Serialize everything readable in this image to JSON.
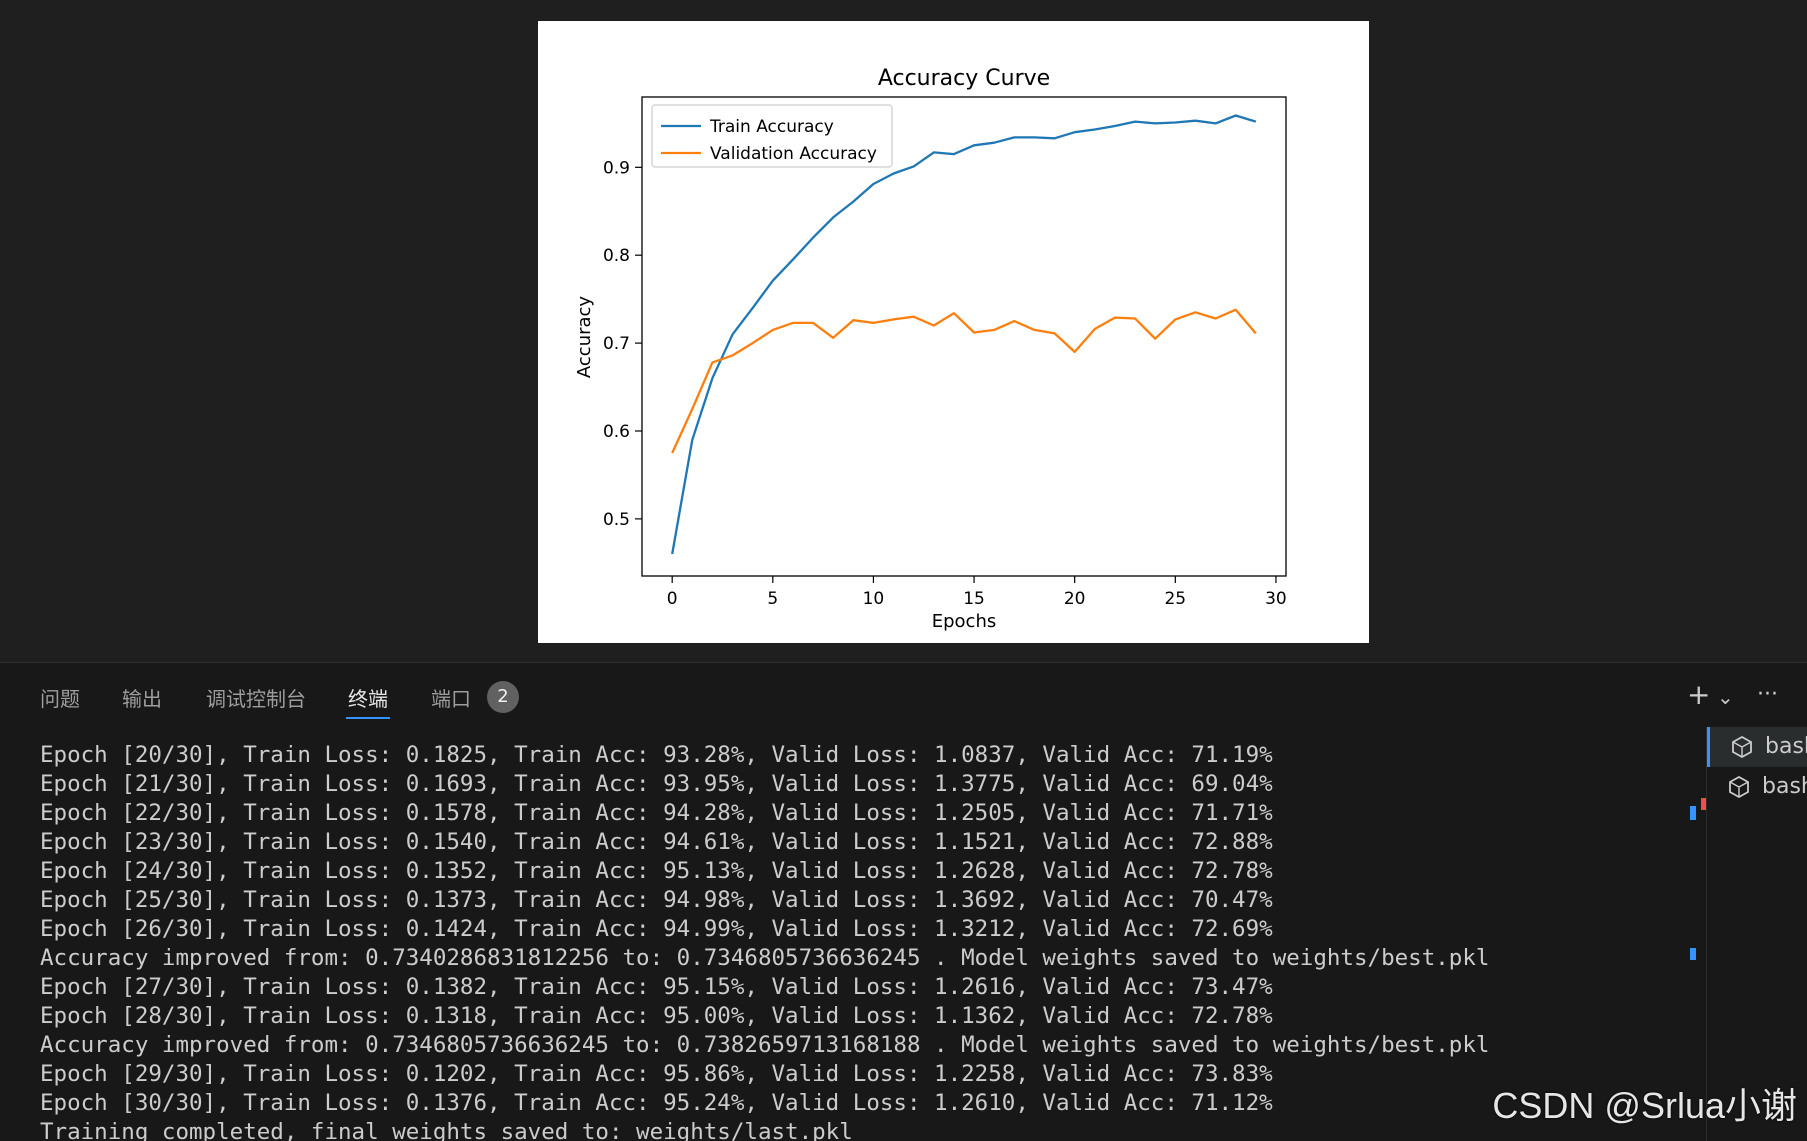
{
  "chart_data": {
    "type": "line",
    "title": "Accuracy Curve",
    "xlabel": "Epochs",
    "ylabel": "Accuracy",
    "xlim": [
      -1.5,
      30.5
    ],
    "ylim": [
      0.435,
      0.98
    ],
    "xticks": [
      0,
      5,
      10,
      15,
      20,
      25,
      30
    ],
    "yticks": [
      0.5,
      0.6,
      0.7,
      0.8,
      0.9
    ],
    "legend_position": "top-left",
    "grid": false,
    "x": [
      0,
      1,
      2,
      3,
      4,
      5,
      6,
      7,
      8,
      9,
      10,
      11,
      12,
      13,
      14,
      15,
      16,
      17,
      18,
      19,
      20,
      21,
      22,
      23,
      24,
      25,
      26,
      27,
      28,
      29
    ],
    "series": [
      {
        "name": "Train Accuracy",
        "color": "#1f77b4",
        "values": [
          0.46,
          0.59,
          0.66,
          0.71,
          0.74,
          0.771,
          0.795,
          0.82,
          0.843,
          0.861,
          0.881,
          0.893,
          0.901,
          0.917,
          0.915,
          0.925,
          0.928,
          0.934,
          0.934,
          0.933,
          0.94,
          0.943,
          0.947,
          0.952,
          0.95,
          0.951,
          0.953,
          0.95,
          0.959,
          0.952
        ]
      },
      {
        "name": "Validation Accuracy",
        "color": "#ff7f0e",
        "values": [
          0.575,
          0.625,
          0.678,
          0.686,
          0.7,
          0.715,
          0.723,
          0.723,
          0.706,
          0.726,
          0.723,
          0.727,
          0.73,
          0.72,
          0.734,
          0.712,
          0.715,
          0.725,
          0.715,
          0.711,
          0.69,
          0.716,
          0.729,
          0.728,
          0.705,
          0.727,
          0.735,
          0.728,
          0.738,
          0.711
        ]
      }
    ]
  },
  "panel": {
    "tabs": [
      {
        "label": "问题",
        "active": false
      },
      {
        "label": "输出",
        "active": false
      },
      {
        "label": "调试控制台",
        "active": false
      },
      {
        "label": "终端",
        "active": true
      },
      {
        "label": "端口",
        "active": false
      }
    ],
    "ports_badge": "2",
    "actions": {
      "add": "+",
      "dropdown": "⌄",
      "more": "···"
    }
  },
  "terminal": {
    "lines": [
      "Epoch [20/30], Train Loss: 0.1825, Train Acc: 93.28%, Valid Loss: 1.0837, Valid Acc: 71.19%",
      "Epoch [21/30], Train Loss: 0.1693, Train Acc: 93.95%, Valid Loss: 1.3775, Valid Acc: 69.04%",
      "Epoch [22/30], Train Loss: 0.1578, Train Acc: 94.28%, Valid Loss: 1.2505, Valid Acc: 71.71%",
      "Epoch [23/30], Train Loss: 0.1540, Train Acc: 94.61%, Valid Loss: 1.1521, Valid Acc: 72.88%",
      "Epoch [24/30], Train Loss: 0.1352, Train Acc: 95.13%, Valid Loss: 1.2628, Valid Acc: 72.78%",
      "Epoch [25/30], Train Loss: 0.1373, Train Acc: 94.98%, Valid Loss: 1.3692, Valid Acc: 70.47%",
      "Epoch [26/30], Train Loss: 0.1424, Train Acc: 94.99%, Valid Loss: 1.3212, Valid Acc: 72.69%",
      "Accuracy improved from: 0.7340286831812256 to: 0.7346805736636245 . Model weights saved to weights/best.pkl",
      "Epoch [27/30], Train Loss: 0.1382, Train Acc: 95.15%, Valid Loss: 1.2616, Valid Acc: 73.47%",
      "Epoch [28/30], Train Loss: 0.1318, Train Acc: 95.00%, Valid Loss: 1.1362, Valid Acc: 72.78%",
      "Accuracy improved from: 0.7346805736636245 to: 0.7382659713168188 . Model weights saved to weights/best.pkl",
      "Epoch [29/30], Train Loss: 0.1202, Train Acc: 95.86%, Valid Loss: 1.2258, Valid Acc: 73.83%",
      "Epoch [30/30], Train Loss: 0.1376, Train Acc: 95.24%, Valid Loss: 1.2610, Valid Acc: 71.12%",
      "Training completed, final weights saved to: weights/last.pkl"
    ]
  },
  "terminal_list": {
    "items": [
      {
        "label": "bash",
        "icon": "terminal-shell-icon"
      },
      {
        "label": "bash",
        "icon": "terminal-shell-icon"
      }
    ]
  },
  "watermark": "CSDN @Srlua小谢"
}
